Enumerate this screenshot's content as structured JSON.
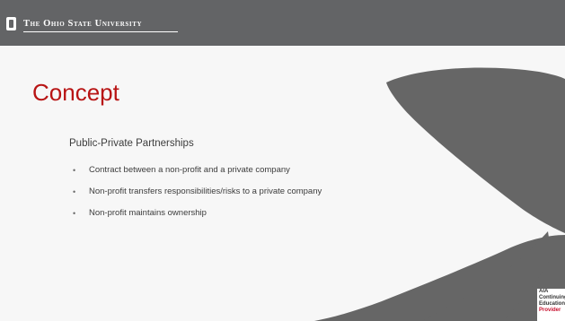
{
  "header": {
    "university_name": "The Ohio State University",
    "bar_color": "#636466",
    "logo_icon": "osu-block-o-logo"
  },
  "slide": {
    "title": "Concept",
    "title_color": "#b81414",
    "subtitle": "Public-Private Partnerships",
    "bullet_marker": "•",
    "bullets": [
      "Contract between a non-profit and a private company",
      "Non-profit transfers responsibilities/risks to a private company",
      "Non-profit maintains ownership"
    ]
  },
  "decoration": {
    "leaf_color": "#666666",
    "icon": "leaf-petals-graphic"
  },
  "badge": {
    "line1": "AIA",
    "line2": "Continuing",
    "line3": "Education",
    "line4": "Provider",
    "accent_color": "#c8102e"
  }
}
